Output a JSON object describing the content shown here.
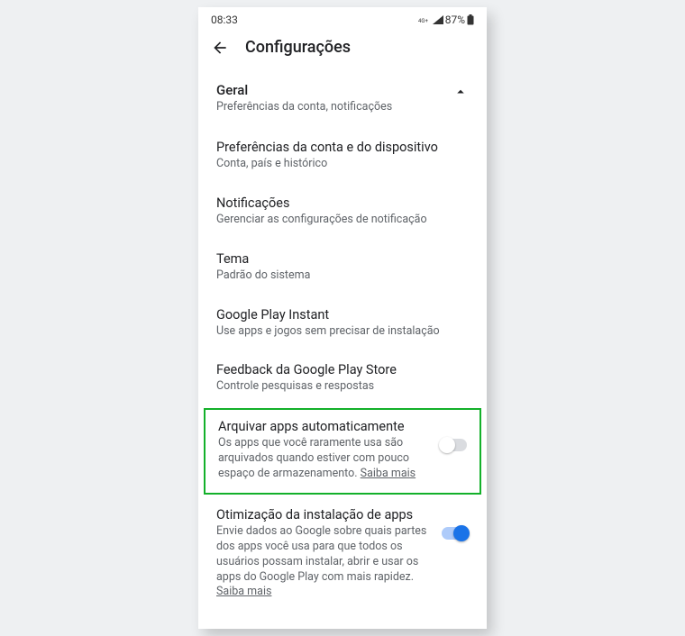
{
  "statusbar": {
    "time": "08:33",
    "signal": "87%",
    "net_icon_label": "4G+"
  },
  "header": {
    "title": "Configurações"
  },
  "general": {
    "title": "Geral",
    "subtitle": "Preferências da conta, notificações"
  },
  "items": {
    "acct": {
      "title": "Preferências da conta e do dispositivo",
      "sub": "Conta, país e histórico"
    },
    "notif": {
      "title": "Notificações",
      "sub": "Gerenciar as configurações de notificação"
    },
    "theme": {
      "title": "Tema",
      "sub": "Padrão do sistema"
    },
    "instant": {
      "title": "Google Play Instant",
      "sub": "Use apps e jogos sem precisar de instalação"
    },
    "feedback": {
      "title": "Feedback da Google Play Store",
      "sub": "Controle pesquisas e respostas"
    }
  },
  "archive": {
    "title": "Arquivar apps automaticamente",
    "sub": "Os apps que você raramente usa são arquivados quando estiver com pouco espaço de armazenamento. ",
    "link": "Saiba mais",
    "toggle": false
  },
  "optimize": {
    "title": "Otimização da instalação de apps",
    "sub": "Envie dados ao Google sobre quais partes dos apps você usa para que todos os usuários possam instalar, abrir e usar os apps do Google Play com mais rapidez. ",
    "link": "Saiba mais",
    "toggle": true
  }
}
